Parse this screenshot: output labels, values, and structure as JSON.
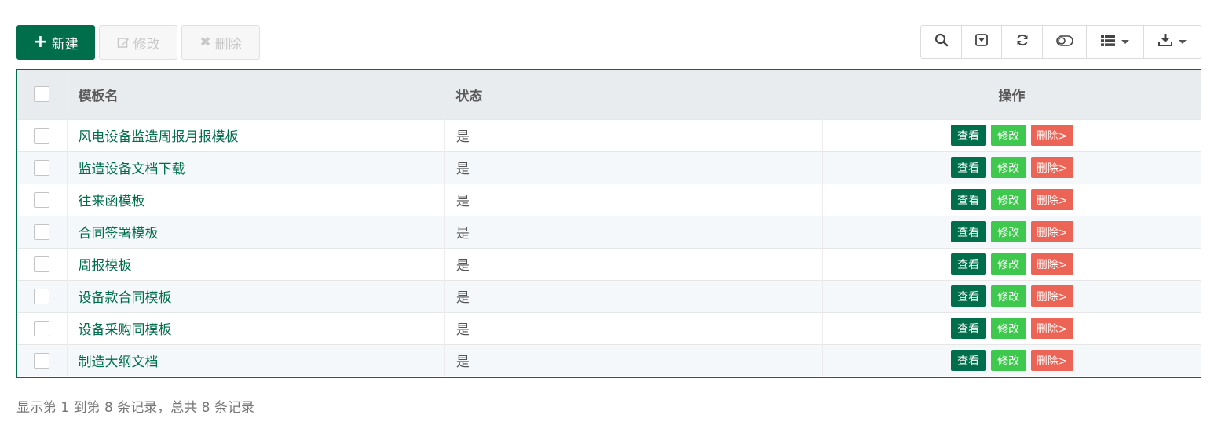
{
  "toolbar": {
    "new_label": "新建",
    "edit_label": "修改",
    "delete_label": "删除"
  },
  "table": {
    "headers": {
      "name": "模板名",
      "status": "状态",
      "ops": "操作"
    },
    "rows": [
      {
        "name": "风电设备监造周报月报模板",
        "status": "是"
      },
      {
        "name": "监造设备文档下载",
        "status": "是"
      },
      {
        "name": "往来函模板",
        "status": "是"
      },
      {
        "name": "合同签署模板",
        "status": "是"
      },
      {
        "name": "周报模板",
        "status": "是"
      },
      {
        "name": "设备款合同模板",
        "status": "是"
      },
      {
        "name": "设备采购同模板",
        "status": "是"
      },
      {
        "name": "制造大纲文档",
        "status": "是"
      }
    ],
    "row_actions": {
      "view": "查看",
      "edit": "修改",
      "delete": "删除>"
    }
  },
  "pagination": {
    "summary": "显示第 1 到第 8 条记录，总共 8 条记录"
  },
  "colors": {
    "primary": "#006e4b",
    "edit": "#3ec84d",
    "danger": "#ec6455"
  }
}
